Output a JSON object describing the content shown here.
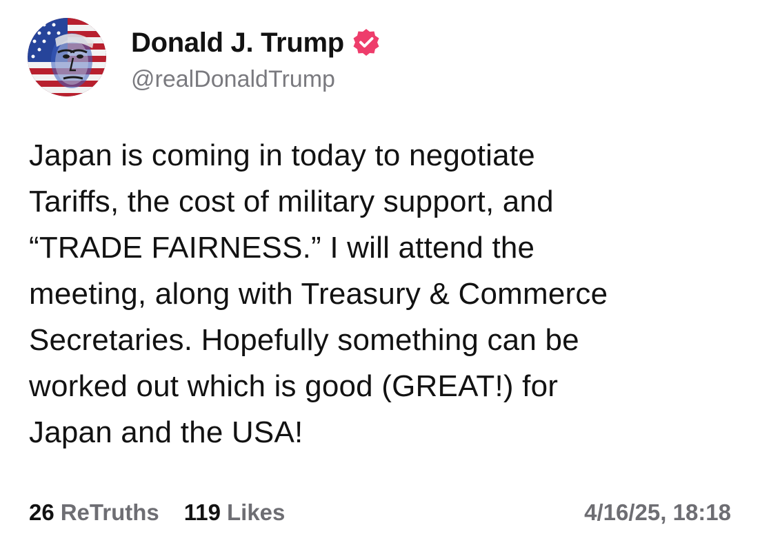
{
  "author": {
    "display_name": "Donald J. Trump",
    "handle": "@realDonaldTrump",
    "verified_color": "#ee3d6b"
  },
  "post": {
    "text": "Japan is coming in today to negotiate\nTariffs, the cost of military support, and\n“TRADE FAIRNESS.” I will attend the\nmeeting, along with Treasury & Commerce\nSecretaries. Hopefully something can be\nworked out which is good (GREAT!) for\nJapan and the USA!"
  },
  "stats": {
    "retruths_count": "26",
    "retruths_label": "ReTruths",
    "likes_count": "119",
    "likes_label": "Likes"
  },
  "timestamp": "4/16/25, 18:18",
  "icons": {
    "avatar": "profile-avatar",
    "verified": "verified-badge-icon"
  }
}
